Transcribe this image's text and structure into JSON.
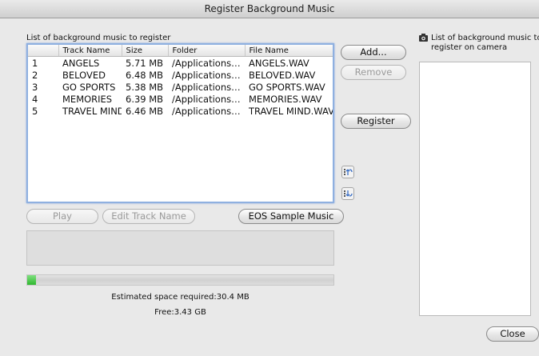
{
  "window": {
    "title": "Register Background Music"
  },
  "left_panel": {
    "list_label": "List of background music to register",
    "columns": [
      "",
      "Track Name",
      "Size",
      "Folder",
      "File Name"
    ],
    "rows": [
      [
        "1",
        "ANGELS",
        "5.71 MB",
        "/Applications…",
        "ANGELS.WAV"
      ],
      [
        "2",
        "BELOVED",
        "6.48 MB",
        "/Applications…",
        "BELOVED.WAV"
      ],
      [
        "3",
        "GO SPORTS",
        "5.38 MB",
        "/Applications…",
        "GO SPORTS.WAV"
      ],
      [
        "4",
        "MEMORIES",
        "6.39 MB",
        "/Applications…",
        "MEMORIES.WAV"
      ],
      [
        "5",
        "TRAVEL MIND",
        "6.46 MB",
        "/Applications…",
        "TRAVEL MIND.WAV"
      ]
    ]
  },
  "buttons": {
    "add": "Add...",
    "remove": "Remove",
    "register": "Register",
    "play": "Play",
    "edit_track_name": "Edit Track Name",
    "eos_sample_music": "EOS Sample Music",
    "close": "Close"
  },
  "progress": {
    "value_fraction": 0.01,
    "color": "#2fb82f"
  },
  "space": {
    "estimated": "Estimated space required:30.4 MB",
    "free": "Free:3.43 GB"
  },
  "right_panel": {
    "label_line1": "List of background music to",
    "label_line2": "register on camera",
    "icon": "camera-icon"
  }
}
